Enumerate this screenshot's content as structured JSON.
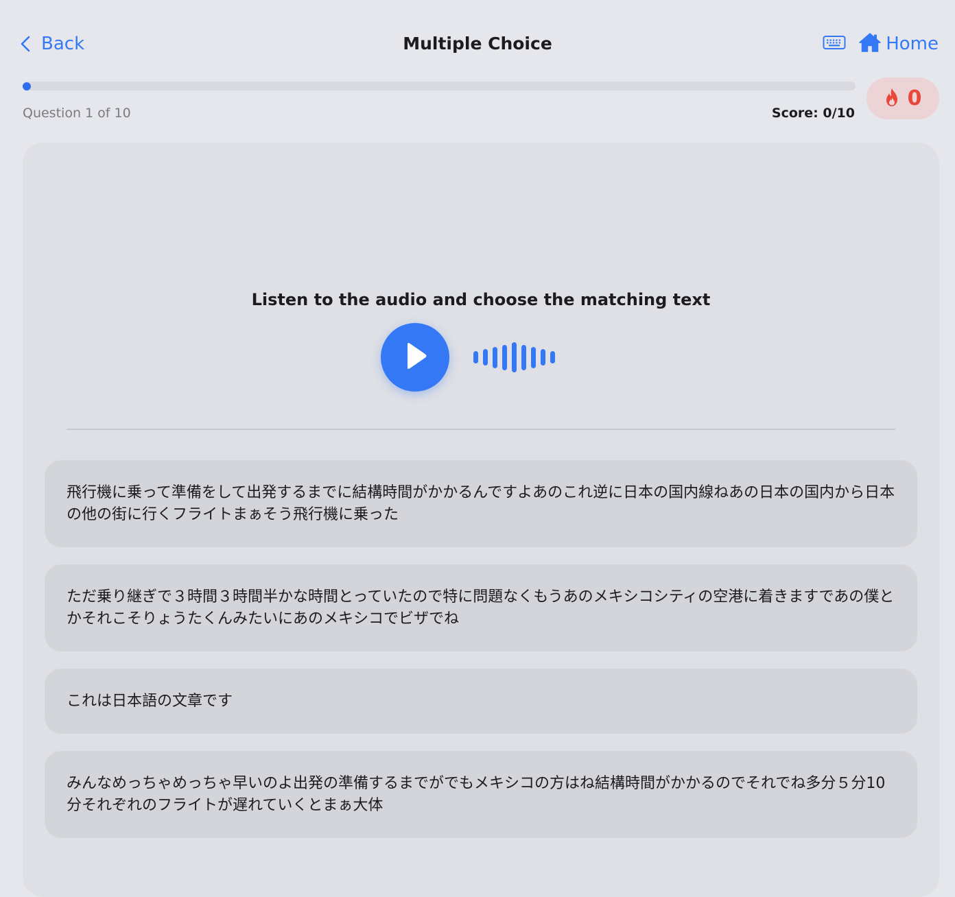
{
  "nav": {
    "back_label": "Back",
    "title": "Multiple Choice",
    "home_label": "Home"
  },
  "progress": {
    "question_text": "Question 1 of 10",
    "score_text": "Score: 0/10",
    "fraction": 0.1
  },
  "streak": {
    "count": "0"
  },
  "question": {
    "prompt": "Listen to the audio and choose the matching text",
    "waveform_levels": [
      0.4,
      0.55,
      0.7,
      0.85,
      1.0,
      0.85,
      0.7,
      0.55,
      0.4
    ]
  },
  "options": [
    "飛行機に乗って準備をして出発するまでに結構時間がかかるんですよあのこれ逆に日本の国内線ねあの日本の国内から日本の他の街に行くフライトまぁそう飛行機に乗った",
    "ただ乗り継ぎで３時間３時間半かな時間とっていたので特に問題なくもうあのメキシコシティの空港に着きますであの僕とかそれこそりょうたくんみたいにあのメキシコでビザでね",
    "これは日本語の文章です",
    "みんなめっちゃめっちゃ早いのよ出発の準備するまでがでもメキシコの方はね結構時間がかかるのでそれでね多分５分10分それぞれのフライトが遅れていくとまぁ大体"
  ],
  "colors": {
    "accent": "#3478f6",
    "streak_bg": "#ecd3d5",
    "streak_text": "#e8473a",
    "background": "#e6e7ec",
    "card": "#dfe0e5",
    "option_bg": "#d4d5da"
  },
  "icons": {
    "back": "chevron-left-icon",
    "keyboard": "keyboard-icon",
    "home": "home-icon",
    "streak": "flame-icon",
    "play": "play-icon"
  }
}
